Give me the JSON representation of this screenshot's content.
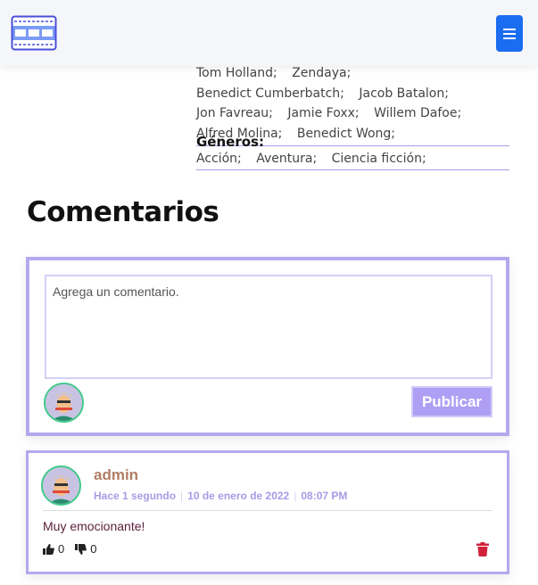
{
  "navbar": {
    "logo_icon": "film-strip-icon",
    "menu_icon": "hamburger-menu-icon",
    "accent": "#1a6df0"
  },
  "movie": {
    "cast": [
      "Tom Holland;",
      "Zendaya;",
      "Benedict Cumberbatch;",
      "Jacob Batalon;",
      "Jon Favreau;",
      "Jamie Foxx;",
      "Willem Dafoe;",
      "Alfred Molina;",
      "Benedict Wong;"
    ],
    "genres_title": "Géneros:",
    "genres": [
      "Acción;",
      "Aventura;",
      "Ciencia ficción;"
    ]
  },
  "comments_section": {
    "title": "Comentarios",
    "form": {
      "placeholder": "Agrega un comentario.",
      "publish_label": "Publicar"
    },
    "items": [
      {
        "author": "admin",
        "relative_time": "Hace 1 segundo",
        "date": "10 de enero de 2022",
        "time": "08:07 PM",
        "text": "Muy emocionante!",
        "likes": "0",
        "dislikes": "0"
      }
    ]
  },
  "colors": {
    "card_border": "#b3a9ee",
    "author": "#b07d66",
    "meta": "#a99be6",
    "delete": "#d0223a"
  }
}
